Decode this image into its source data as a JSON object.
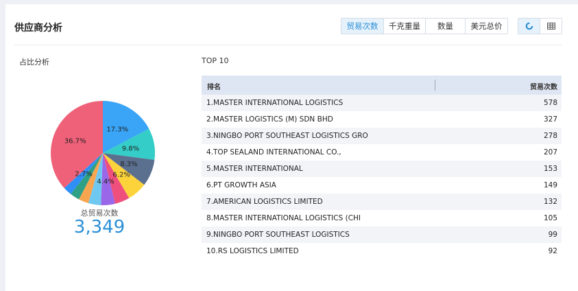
{
  "title": "供应商分析",
  "metric_tabs": [
    "贸易次数",
    "千克重量",
    "数量",
    "美元总价"
  ],
  "active_tab_index": 0,
  "view_buttons": [
    {
      "icon": "donut-chart-icon",
      "active": true
    },
    {
      "icon": "table-grid-icon",
      "active": false
    }
  ],
  "left_section": {
    "title": "占比分析"
  },
  "right_section": {
    "title": "TOP 10"
  },
  "chart_data": {
    "type": "pie",
    "slices": [
      {
        "label": "",
        "percent": 17.3,
        "color": "#3aa4f6",
        "text": "17.3%"
      },
      {
        "label": "",
        "percent": 9.8,
        "color": "#35cdc8",
        "text": "9.8%"
      },
      {
        "label": "",
        "percent": 8.3,
        "color": "#5b6f8f",
        "text": "8.3%"
      },
      {
        "label": "",
        "percent": 6.2,
        "color": "#fdd33b",
        "text": "6.2%"
      },
      {
        "label": "",
        "percent": 4.6,
        "color": "#ee4f7d",
        "text": ""
      },
      {
        "label": "",
        "percent": 4.4,
        "color": "#9a67e8",
        "text": "4.4%"
      },
      {
        "label": "",
        "percent": 3.9,
        "color": "#6fc8ef",
        "text": ""
      },
      {
        "label": "",
        "percent": 3.1,
        "color": "#f8a54f",
        "text": ""
      },
      {
        "label": "",
        "percent": 3.0,
        "color": "#2f9f86",
        "text": ""
      },
      {
        "label": "",
        "percent": 2.7,
        "color": "#2f8ff6",
        "text": "2.7%"
      },
      {
        "label": "",
        "percent": 36.7,
        "color": "#ef6179",
        "text": "36.7%"
      }
    ]
  },
  "total": {
    "label": "总贸易次数",
    "value": "3,349"
  },
  "table": {
    "headers": [
      "排名",
      "贸易次数"
    ],
    "rows": [
      {
        "name": "1.MASTER INTERNATIONAL LOGISTICS",
        "count": "578"
      },
      {
        "name": "2.MASTER LOGISTICS (M) SDN BHD",
        "count": "327"
      },
      {
        "name": "3.NINGBO PORT SOUTHEAST LOGISTICS GRO",
        "count": "278"
      },
      {
        "name": "4.TOP SEALAND INTERNATIONAL CO.,",
        "count": "207"
      },
      {
        "name": "5.MASTER INTERNATIONAL",
        "count": "153"
      },
      {
        "name": "6.PT GROWTH ASIA",
        "count": "149"
      },
      {
        "name": "7.AMERICAN LOGISTICS LIMITED",
        "count": "132"
      },
      {
        "name": "8.MASTER INTERNATIONAL LOGISTICS (CHI",
        "count": "105"
      },
      {
        "name": "9.NINGBO PORT SOUTHEAST LOGISTICS",
        "count": "99"
      },
      {
        "name": "10.RS LOGISTICS LIMITED",
        "count": "92"
      }
    ]
  }
}
